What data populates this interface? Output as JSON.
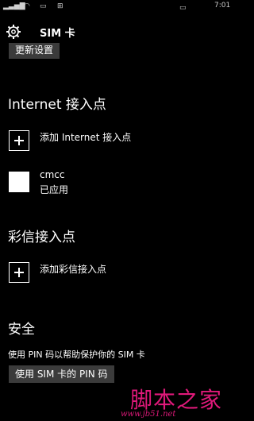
{
  "status_bar": {
    "time": "7:01"
  },
  "header": {
    "title": "SIM 卡",
    "settings_icon": "gear-icon"
  },
  "update_settings_button": "更新设置",
  "internet_apn": {
    "heading": "Internet 接入点",
    "add_label": "添加 Internet 接入点",
    "items": [
      {
        "name": "cmcc",
        "status": "已应用"
      }
    ]
  },
  "mms_apn": {
    "heading": "彩信接入点",
    "add_label": "添加彩信接入点"
  },
  "security": {
    "heading": "安全",
    "description": "使用 PIN 码以帮助保护你的 SIM 卡",
    "pin_button": "使用 SIM 卡的 PIN 码"
  },
  "watermark": {
    "logo": "脚本之家",
    "url": "www.jb51.net"
  }
}
